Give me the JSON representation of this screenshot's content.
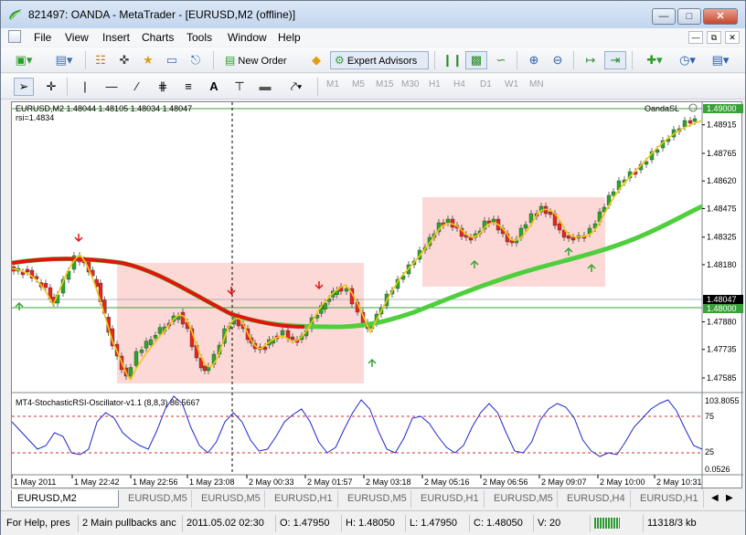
{
  "window": {
    "title": "821497: OANDA - MetaTrader - [EURUSD,M2 (offline)]"
  },
  "menu": [
    "File",
    "View",
    "Insert",
    "Charts",
    "Tools",
    "Window",
    "Help"
  ],
  "toolbar": {
    "new_order": "New Order",
    "expert_advisors": "Expert Advisors"
  },
  "timeframes": [
    "M1",
    "M5",
    "M15",
    "M30",
    "H1",
    "H4",
    "D1",
    "W1",
    "MN"
  ],
  "chart": {
    "symbol_info": "EURUSD,M2  1.48044 1.48105 1.48034 1.48047",
    "rsi_info": "rsi=1.4834",
    "broker_tag": "OandaSL",
    "price_labels": [
      "1.49000",
      "1.48915",
      "1.48765",
      "1.48620",
      "1.48475",
      "1.48325",
      "1.48180",
      "1.48047",
      "1.48000",
      "1.47880",
      "1.47735",
      "1.47585"
    ],
    "time_labels": [
      "1 May 2011",
      "1 May 22:42",
      "1 May 22:56",
      "1 May 23:08",
      "2 May 00:33",
      "2 May 01:57",
      "2 May 03:18",
      "2 May 05:16",
      "2 May 06:56",
      "2 May 09:07",
      "2 May 10:00",
      "2 May 10:31"
    ],
    "osc_info": "MT4-StochasticRSI-Oscillator-v1.1 (8,8,3) 86.5667",
    "osc_labels": [
      "103.8055",
      "75",
      "25",
      "0.0526"
    ],
    "osc_level_75": "75",
    "osc_level_25": "25",
    "colors": {
      "bull": "#27a927",
      "bear": "#e8241b",
      "ma_up": "#4fcf3d",
      "ma_down": "#e3130f",
      "box": "#fcd9d6",
      "fast": "#f3c81a",
      "osc": "#1d27c9"
    }
  },
  "chart_data": {
    "type": "candlestick",
    "symbol": "EURUSD",
    "timeframe": "M2",
    "ylim": [
      1.47585,
      1.49
    ],
    "current_price": 1.48047,
    "ohlc": [
      1.48044,
      1.48105,
      1.48034,
      1.48047
    ],
    "stoch_rsi": 86.5667,
    "osc_ylim": [
      0.0526,
      103.8055
    ],
    "osc_levels": [
      75,
      25
    ]
  },
  "tabs": [
    "EURUSD,M2 (offline)",
    "EURUSD,M5",
    "EURUSD,M5",
    "EURUSD,H1",
    "EURUSD,M5",
    "EURUSD,H1",
    "EURUSD,M5",
    "EURUSD,H4",
    "EURUSD,H1"
  ],
  "status": {
    "help": "For Help, pres",
    "profile": "2 Main pullbacks anc",
    "time": "2011.05.02 02:30",
    "open": "O: 1.47950",
    "high": "H: 1.48050",
    "low": "L: 1.47950",
    "close": "C: 1.48050",
    "volume": "V: 20",
    "traffic": "11318/3 kb"
  }
}
